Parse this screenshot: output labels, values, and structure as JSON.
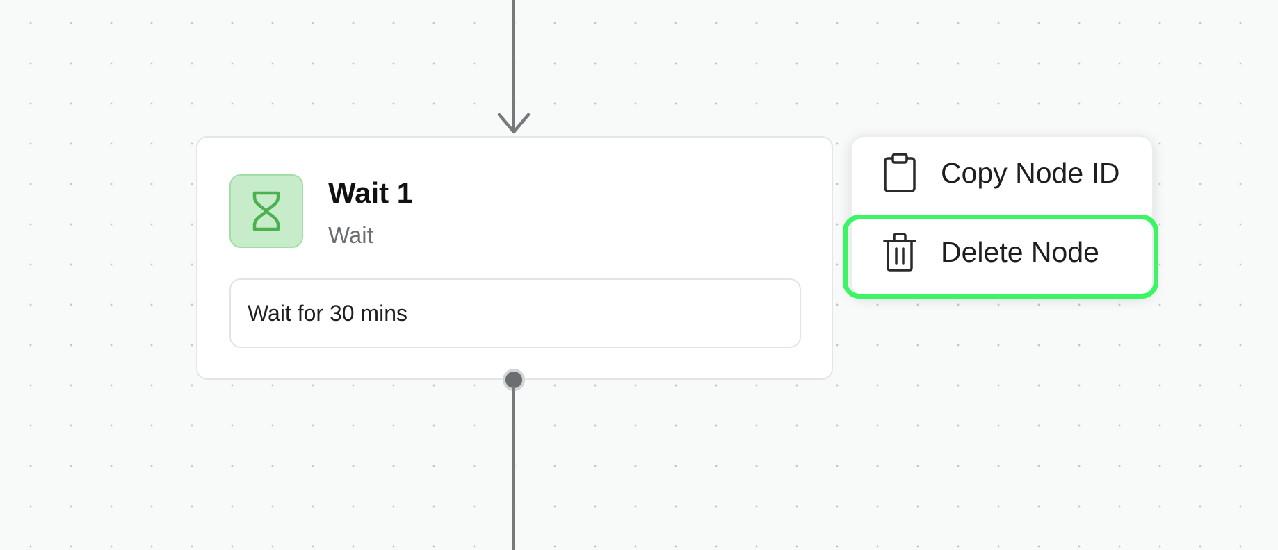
{
  "canvas": {
    "background": "#f8f9f9",
    "dot_color": "#c4c7c9",
    "edge_color": "#777a7c"
  },
  "node": {
    "title": "Wait 1",
    "subtitle": "Wait",
    "description": "Wait for 30 mins",
    "icon": "hourglass-icon",
    "icon_bg": "#c7ecc9",
    "icon_color": "#4caf50"
  },
  "context_menu": {
    "items": [
      {
        "label": "Copy Node ID",
        "icon": "clipboard-icon"
      },
      {
        "label": "Delete Node",
        "icon": "trash-icon"
      }
    ],
    "highlight_color": "#3bf565"
  }
}
